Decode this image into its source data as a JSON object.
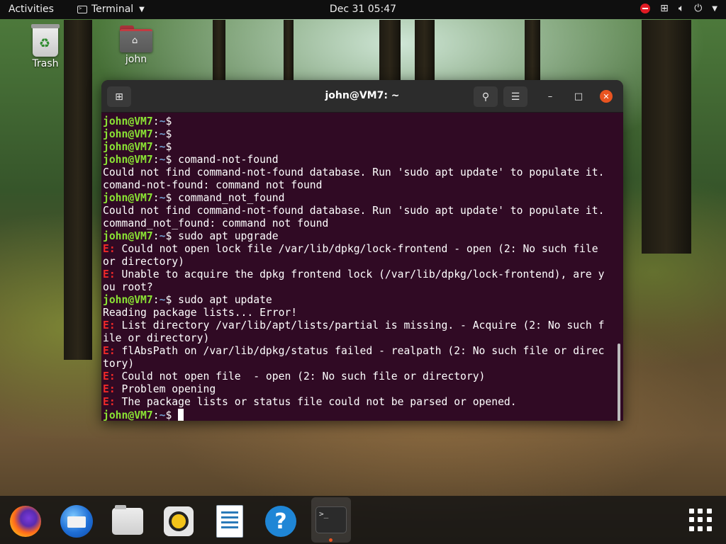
{
  "topbar": {
    "activities": "Activities",
    "app_name": "Terminal",
    "clock": "Dec 31  05:47"
  },
  "desktop": {
    "icons": [
      {
        "label": "Trash"
      },
      {
        "label": "john"
      }
    ]
  },
  "window": {
    "title": "john@VM7: ~",
    "accent_close": "#e95420",
    "background": "#300a24"
  },
  "terminal": {
    "prompt_user": "john@VM7",
    "prompt_path": ":~",
    "prompt_symbol": "$",
    "lines": [
      {
        "type": "prompt",
        "cmd": ""
      },
      {
        "type": "prompt",
        "cmd": ""
      },
      {
        "type": "prompt",
        "cmd": ""
      },
      {
        "type": "prompt",
        "cmd": "comand-not-found"
      },
      {
        "type": "out",
        "text": "Could not find command-not-found database. Run 'sudo apt update' to populate it."
      },
      {
        "type": "out",
        "text": "comand-not-found: command not found"
      },
      {
        "type": "prompt",
        "cmd": "command_not_found"
      },
      {
        "type": "out",
        "text": "Could not find command-not-found database. Run 'sudo apt update' to populate it."
      },
      {
        "type": "out",
        "text": "command_not_found: command not found"
      },
      {
        "type": "prompt",
        "cmd": "sudo apt upgrade"
      },
      {
        "type": "err",
        "text": " Could not open lock file /var/lib/dpkg/lock-frontend - open (2: No such file"
      },
      {
        "type": "out",
        "text": "or directory)"
      },
      {
        "type": "err",
        "text": " Unable to acquire the dpkg frontend lock (/var/lib/dpkg/lock-frontend), are y"
      },
      {
        "type": "out",
        "text": "ou root?"
      },
      {
        "type": "prompt",
        "cmd": "sudo apt update"
      },
      {
        "type": "out",
        "text": "Reading package lists... Error!"
      },
      {
        "type": "err",
        "text": " List directory /var/lib/apt/lists/partial is missing. - Acquire (2: No such f"
      },
      {
        "type": "out",
        "text": "ile or directory)"
      },
      {
        "type": "err",
        "text": " flAbsPath on /var/lib/dpkg/status failed - realpath (2: No such file or direc"
      },
      {
        "type": "out",
        "text": "tory)"
      },
      {
        "type": "err",
        "text": " Could not open file  - open (2: No such file or directory)"
      },
      {
        "type": "err",
        "text": " Problem opening"
      },
      {
        "type": "err",
        "text": " The package lists or status file could not be parsed or opened."
      },
      {
        "type": "prompt_cursor",
        "cmd": ""
      }
    ],
    "error_prefix": "E:"
  },
  "dock": {
    "items": [
      {
        "icon": "firefox-icon"
      },
      {
        "icon": "thunderbird-icon"
      },
      {
        "icon": "files-icon"
      },
      {
        "icon": "rhythmbox-icon"
      },
      {
        "icon": "libreoffice-writer-icon"
      },
      {
        "icon": "help-icon"
      },
      {
        "icon": "terminal-icon",
        "active": true
      }
    ],
    "terminal_glyph": ">_"
  }
}
